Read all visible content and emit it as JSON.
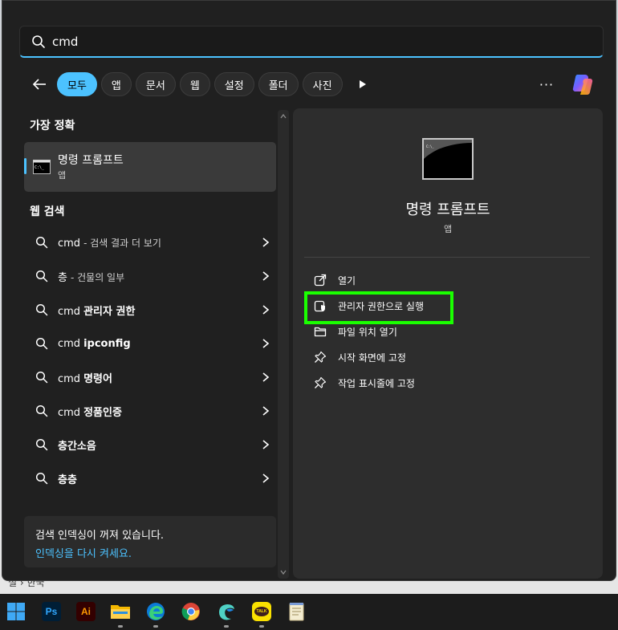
{
  "search": {
    "query": "cmd"
  },
  "filters": {
    "items": [
      {
        "label": "모두",
        "active": true
      },
      {
        "label": "앱",
        "active": false
      },
      {
        "label": "문서",
        "active": false
      },
      {
        "label": "웹",
        "active": false
      },
      {
        "label": "설정",
        "active": false
      },
      {
        "label": "폴더",
        "active": false
      },
      {
        "label": "사진",
        "active": false
      }
    ],
    "more_label": "···"
  },
  "left": {
    "best_match_title": "가장 정확",
    "best_match": {
      "name": "명령 프롬프트",
      "type": "앱"
    },
    "web_search_title": "웹 검색",
    "web_results": [
      {
        "query": "cmd",
        "bold": "",
        "suffix": "- 검색 결과 더 보기"
      },
      {
        "query": "층",
        "bold": "",
        "suffix": "- 건물의 일부"
      },
      {
        "query": "cmd",
        "bold": "관리자 권한",
        "suffix": ""
      },
      {
        "query": "cmd",
        "bold": "ipconfig",
        "suffix": ""
      },
      {
        "query": "cmd",
        "bold": "명령어",
        "suffix": ""
      },
      {
        "query": "cmd",
        "bold": "정품인증",
        "suffix": ""
      },
      {
        "query": "",
        "bold": "층간소음",
        "suffix": ""
      },
      {
        "query": "",
        "bold": "층층",
        "suffix": ""
      }
    ],
    "index_notice": "검색 인덱싱이 꺼져 있습니다.",
    "index_link": "인덱싱을 다시 켜세요."
  },
  "right": {
    "app_name": "명령 프롬프트",
    "app_type": "앱",
    "actions": [
      {
        "label": "열기",
        "icon": "open-external-icon"
      },
      {
        "label": "관리자 권한으로 실행",
        "icon": "admin-shield-icon"
      },
      {
        "label": "파일 위치 열기",
        "icon": "folder-icon"
      },
      {
        "label": "시작 화면에 고정",
        "icon": "pin-icon"
      },
      {
        "label": "작업 표시줄에 고정",
        "icon": "pin-icon"
      }
    ],
    "highlight_color": "#1aff00"
  },
  "behind_window": {
    "breadcrumb": "설 › 한국"
  },
  "taskbar": {
    "apps": [
      "windows-start-icon",
      "photoshop-icon",
      "illustrator-icon",
      "file-explorer-icon",
      "edge-icon",
      "chrome-icon",
      "app-icon",
      "kakaotalk-icon",
      "notepad-icon"
    ],
    "ps_label": "Ps",
    "ai_label": "Ai",
    "talk_label": "TALK"
  },
  "colors": {
    "accent": "#4cc2ff",
    "panel": "#2d2d2d",
    "background": "#202020"
  }
}
